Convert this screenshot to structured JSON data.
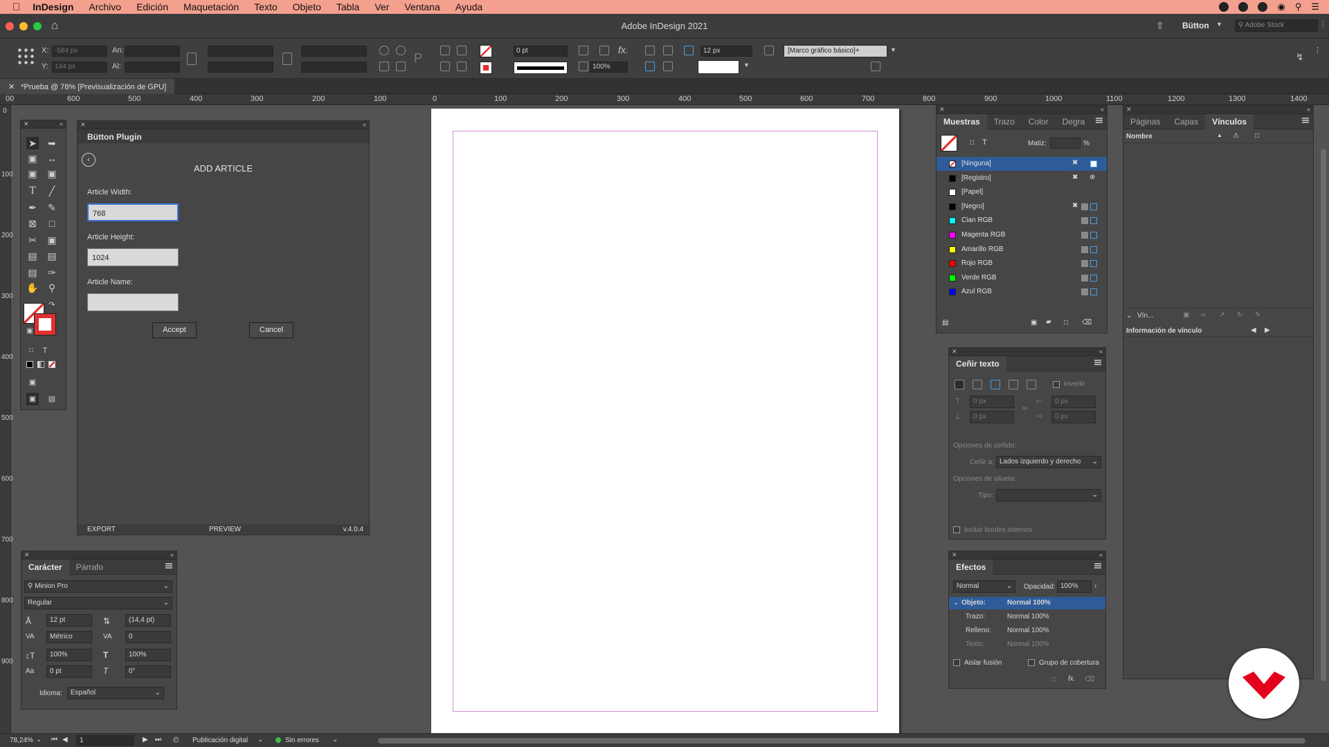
{
  "menubar": {
    "app": "InDesign",
    "items": [
      "Archivo",
      "Edición",
      "Maquetación",
      "Texto",
      "Objeto",
      "Tabla",
      "Ver",
      "Ventana",
      "Ayuda"
    ]
  },
  "window": {
    "title": "Adobe InDesign 2021",
    "workspace": "Bütton",
    "search_placeholder": "Adobe Stock"
  },
  "control": {
    "x_label": "X:",
    "x_value": "-584 px",
    "y_label": "Y:",
    "y_value": "144 px",
    "w_label": "An:",
    "h_label": "Al:",
    "stroke_weight": "0 pt",
    "scale": "100%",
    "size_px": "12 px",
    "object_style": "[Marco gráfico básico]+"
  },
  "doc_tab": {
    "label": "*Prueba @ 78% [Previsualización de GPU]"
  },
  "hruler": [
    "00",
    "600",
    "500",
    "400",
    "300",
    "200",
    "100",
    "0",
    "100",
    "200",
    "300",
    "400",
    "500",
    "600",
    "700",
    "800",
    "900",
    "1000",
    "1100",
    "1200",
    "1300",
    "1400"
  ],
  "vruler": [
    "0",
    "100",
    "200",
    "300",
    "400",
    "500",
    "600",
    "700",
    "800",
    "900"
  ],
  "plugin": {
    "title": "Bütton Plugin",
    "heading": "ADD ARTICLE",
    "width_label": "Article Width:",
    "width_value": "768",
    "height_label": "Article Height:",
    "height_value": "1024",
    "name_label": "Article Name:",
    "name_value": "",
    "accept": "Accept",
    "cancel": "Cancel",
    "footer_export": "EXPORT",
    "footer_preview": "PREVIEW",
    "footer_version": "v.4.0.4"
  },
  "swatches": {
    "tabs": [
      "Muestras",
      "Trazo",
      "Color",
      "Degra"
    ],
    "tint_label": "Matiz:",
    "tint_unit": "%",
    "items": [
      {
        "name": "[Ninguna]",
        "color": "none"
      },
      {
        "name": "[Registro]",
        "color": "#000000"
      },
      {
        "name": "[Papel]",
        "color": "#ffffff"
      },
      {
        "name": "[Negro]",
        "color": "#000000"
      },
      {
        "name": "Cian RGB",
        "color": "#00ffff"
      },
      {
        "name": "Magenta RGB",
        "color": "#ff00ff"
      },
      {
        "name": "Amarillo RGB",
        "color": "#ffff00"
      },
      {
        "name": "Rojo RGB",
        "color": "#ff0000"
      },
      {
        "name": "Verde RGB",
        "color": "#00ff00"
      },
      {
        "name": "Azul RGB",
        "color": "#0000ff"
      }
    ]
  },
  "links": {
    "tabs": [
      "Páginas",
      "Capas",
      "Vínculos"
    ],
    "col_name": "Nombre",
    "section": "Vín...",
    "info": "Información de vínculo"
  },
  "wrap": {
    "title": "Ceñir texto",
    "invert": "Invertir",
    "top": "0 px",
    "bottom": "0 px",
    "left": "0 px",
    "right": "0 px",
    "wrap_options": "Opciones de ceñido:",
    "wrap_to_label": "Ceñir a:",
    "wrap_to_value": "Lados izquierdo y derecho",
    "contour_options": "Opciones de silueta:",
    "type_label": "Tipo:",
    "include_edges": "Incluir bordes internos"
  },
  "effects": {
    "title": "Efectos",
    "mode": "Normal",
    "opacity_label": "Opacidad:",
    "opacity_value": "100%",
    "rows": [
      {
        "label": "Objeto:",
        "value": "Normal 100%"
      },
      {
        "label": "Trazo:",
        "value": "Normal 100%"
      },
      {
        "label": "Relleno:",
        "value": "Normal 100%"
      },
      {
        "label": "Texto:",
        "value": "Normal 100%"
      }
    ],
    "isolate": "Aislar fusión",
    "knockout": "Grupo de cobertura"
  },
  "character": {
    "tabs": [
      "Carácter",
      "Párrafo"
    ],
    "font": "Minion Pro",
    "style": "Regular",
    "size": "12 pt",
    "leading": "(14,4 pt)",
    "kerning": "Métrico",
    "tracking": "0",
    "vscale": "100%",
    "hscale": "100%",
    "baseline": "0 pt",
    "skew": "0°",
    "lang_label": "Idioma:",
    "lang": "Español"
  },
  "status": {
    "zoom": "78,24%",
    "page": "1",
    "intent": "Publicación digital",
    "errors": "Sin errores"
  }
}
